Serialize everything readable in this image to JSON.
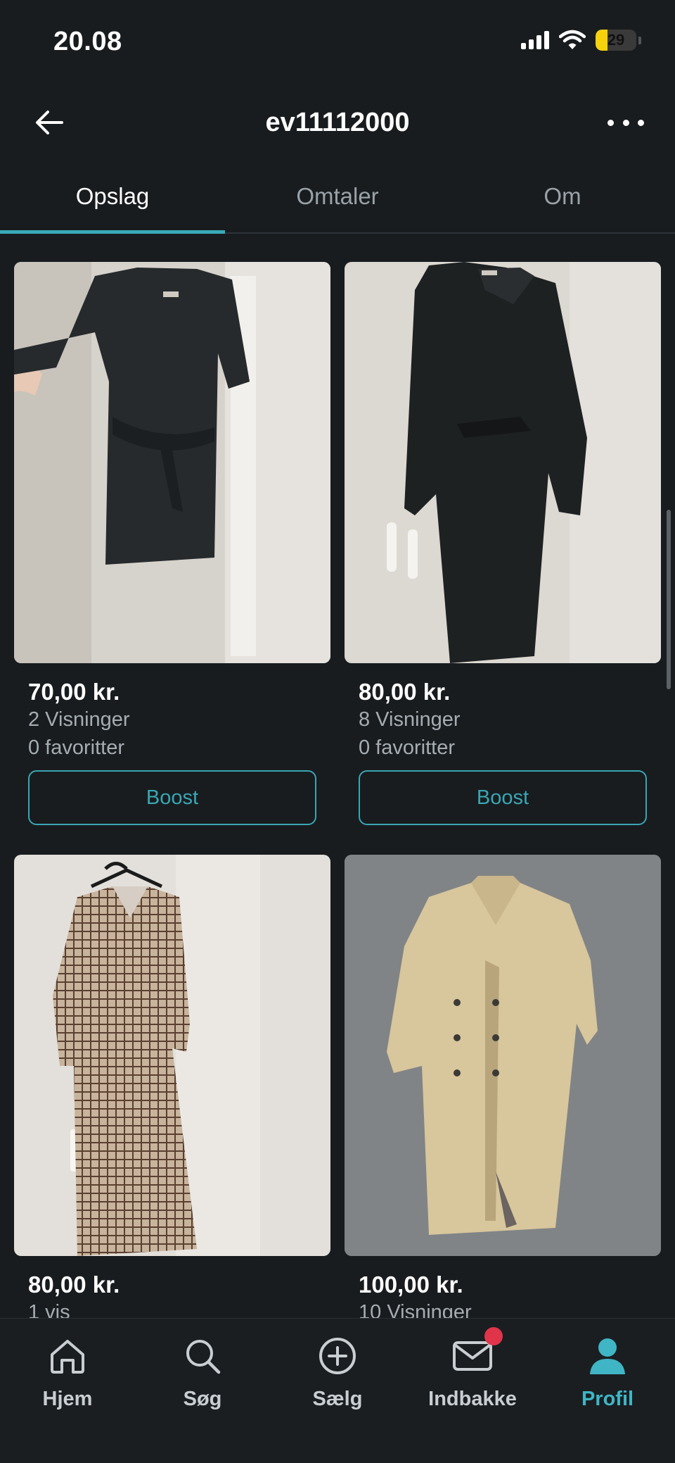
{
  "status_bar": {
    "time": "20.08",
    "battery": "29",
    "battery_level": 0.29,
    "icons": [
      "cellular-signal-icon",
      "wifi-icon",
      "battery-icon"
    ]
  },
  "header": {
    "title": "ev11112000",
    "icons": [
      "back-arrow-icon",
      "more-dots-icon"
    ]
  },
  "tabs": [
    {
      "label": "Opslag",
      "active": true
    },
    {
      "label": "Omtaler",
      "active": false
    },
    {
      "label": "Om",
      "active": false
    }
  ],
  "listings": [
    {
      "price": "70,00 kr.",
      "views": "2 Visninger",
      "favorites": "0 favoritter",
      "boost_label": "Boost"
    },
    {
      "price": "80,00 kr.",
      "views": "8 Visninger",
      "favorites": "0 favoritter",
      "boost_label": "Boost"
    },
    {
      "price": "80,00 kr.",
      "views": "1 vis"
    },
    {
      "price": "100,00 kr.",
      "views": "10 Visninger"
    }
  ],
  "bottom_nav": [
    {
      "label": "Hjem",
      "icon": "home-icon",
      "active": false
    },
    {
      "label": "Søg",
      "icon": "search-icon",
      "active": false
    },
    {
      "label": "Sælg",
      "icon": "plus-circle-icon",
      "active": false
    },
    {
      "label": "Indbakke",
      "icon": "mail-icon",
      "active": false,
      "badge": true
    },
    {
      "label": "Profil",
      "icon": "profile-icon",
      "active": true
    }
  ],
  "colors": {
    "background": "#181c1f",
    "accent": "#3aa6b3",
    "muted_text": "#a6adb2",
    "badge": "#e0344a"
  }
}
